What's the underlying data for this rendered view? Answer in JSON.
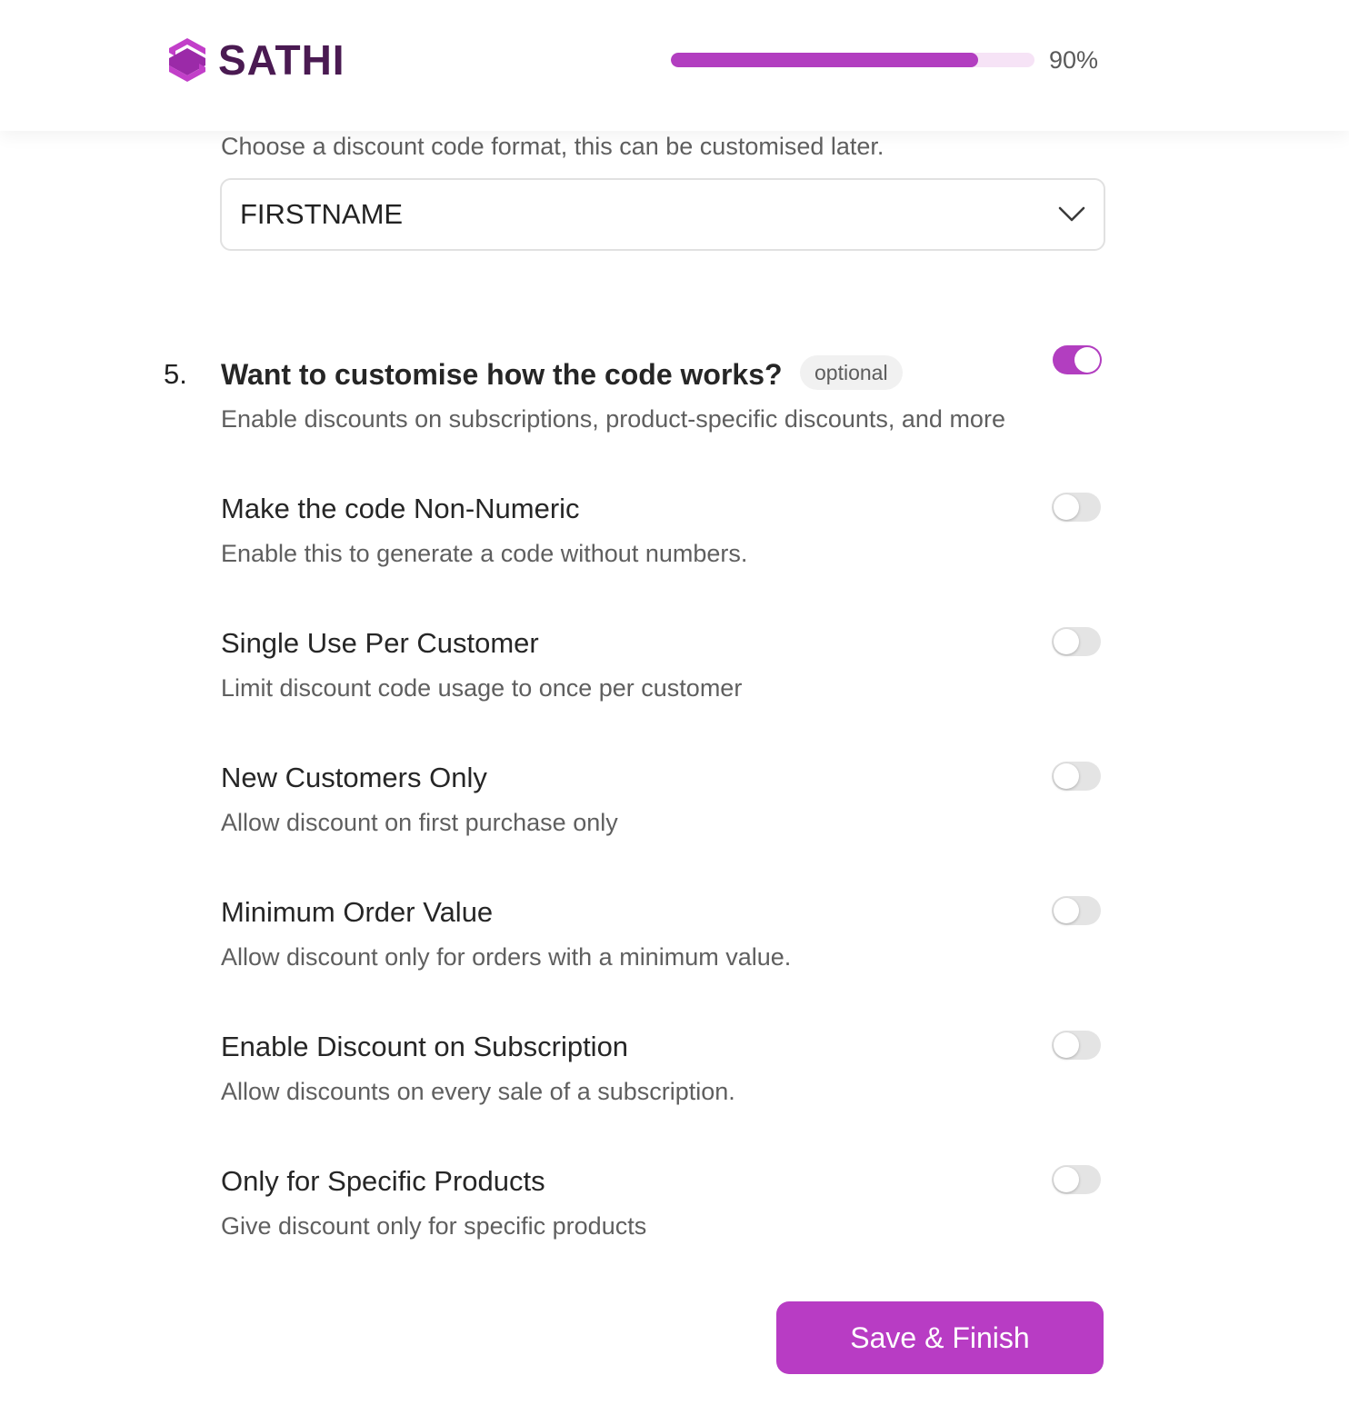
{
  "header": {
    "logo_text": "SATHI",
    "logo_icon": "sathi-logo-icon",
    "progress_fraction": 0.9,
    "progress_text": "90%"
  },
  "code_format": {
    "hint": "Choose a discount code format, this can be customised later.",
    "selected": "FIRSTNAME",
    "dropdown_icon": "chevron-down-icon"
  },
  "question": {
    "number": "5.",
    "title": "Want to customise how the code works?",
    "badge": "optional",
    "subtitle": "Enable discounts on subscriptions, product-specific discounts, and more",
    "enabled": true
  },
  "options": [
    {
      "title": "Make the code Non-Numeric",
      "description": "Enable this to generate a code without numbers.",
      "enabled": false
    },
    {
      "title": "Single Use Per Customer",
      "description": "Limit discount code usage to once per customer",
      "enabled": false
    },
    {
      "title": "New Customers Only",
      "description": "Allow discount on first purchase only",
      "enabled": false
    },
    {
      "title": "Minimum Order Value",
      "description": "Allow discount only for orders with a minimum value.",
      "enabled": false
    },
    {
      "title": "Enable Discount on Subscription",
      "description": "Allow discounts on every sale of a subscription.",
      "enabled": false
    },
    {
      "title": "Only for Specific Products",
      "description": "Give discount only for specific products",
      "enabled": false
    }
  ],
  "actions": {
    "save_label": "Save & Finish"
  },
  "colors": {
    "accent": "#b83cc4",
    "logo_text": "#4a1a52",
    "progress_track": "#f6e3f6",
    "toggle_off": "#e4e4e4"
  }
}
